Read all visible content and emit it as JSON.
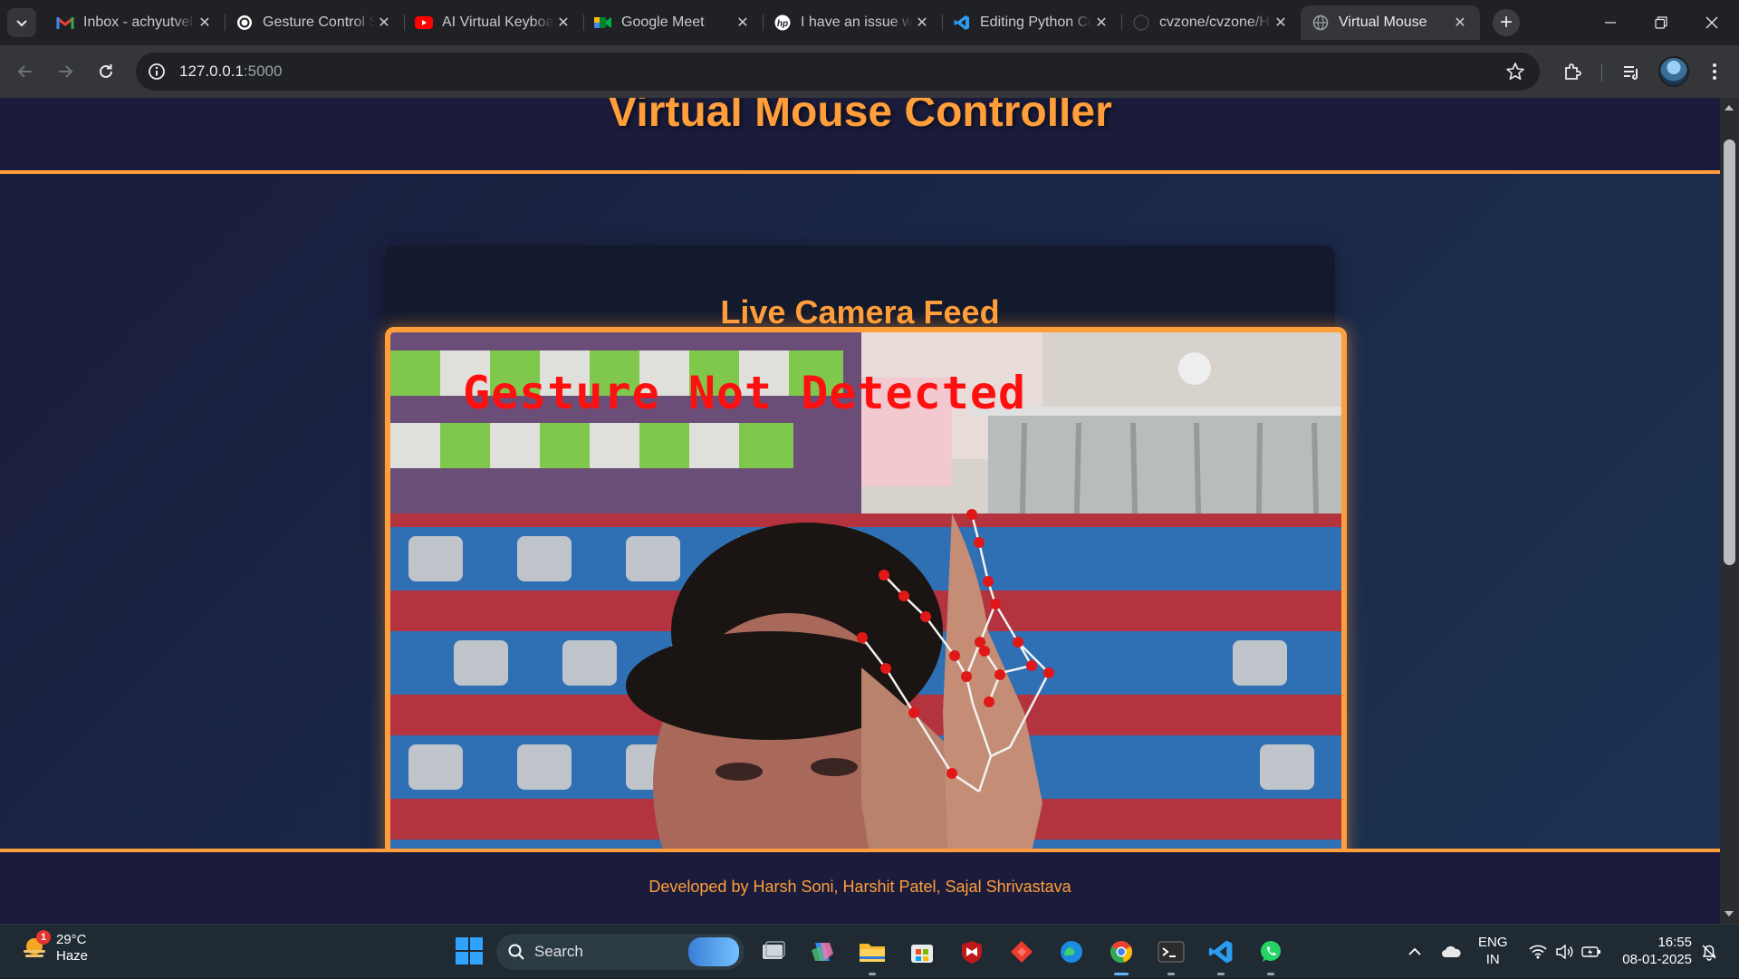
{
  "tabs": [
    {
      "title": "Inbox - achyutvel",
      "icon": "gmail-icon"
    },
    {
      "title": "Gesture Control S",
      "icon": "chatgpt-icon"
    },
    {
      "title": "AI Virtual Keyboard",
      "icon": "youtube-icon"
    },
    {
      "title": "Google Meet",
      "icon": "google-meet-icon"
    },
    {
      "title": "I have an issue wi",
      "icon": "hp-icon"
    },
    {
      "title": "Editing Python Co",
      "icon": "vscode-icon"
    },
    {
      "title": "cvzone/cvzone/H",
      "icon": "github-icon"
    },
    {
      "title": "Virtual Mouse",
      "icon": "globe-icon",
      "active": true
    }
  ],
  "address_bar": {
    "host": "127.0.0.1",
    "port": ":5000"
  },
  "page": {
    "title": "Virtual Mouse Controller",
    "feed_title": "Live Camera Feed",
    "overlay_text": "Gesture Not Detected",
    "footer": "Developed by Harsh Soni, Harshit Patel, Sajal Shrivastava"
  },
  "colors": {
    "accent": "#ff9e3a",
    "overlay_text": "#ff1010",
    "landmark": "#e01818"
  },
  "taskbar": {
    "weather": {
      "temp": "29°C",
      "condition": "Haze",
      "badge": "1"
    },
    "search_label": "Search",
    "apps": [
      "task-view-icon",
      "copilot-icon",
      "file-explorer-icon",
      "microsoft-store-icon",
      "mcafee-icon",
      "anydesk-icon",
      "edge-icon",
      "chrome-icon",
      "terminal-icon",
      "vscode-icon",
      "whatsapp-icon"
    ],
    "lang": {
      "line1": "ENG",
      "line2": "IN"
    },
    "clock": {
      "time": "16:55",
      "date": "08-01-2025"
    }
  }
}
